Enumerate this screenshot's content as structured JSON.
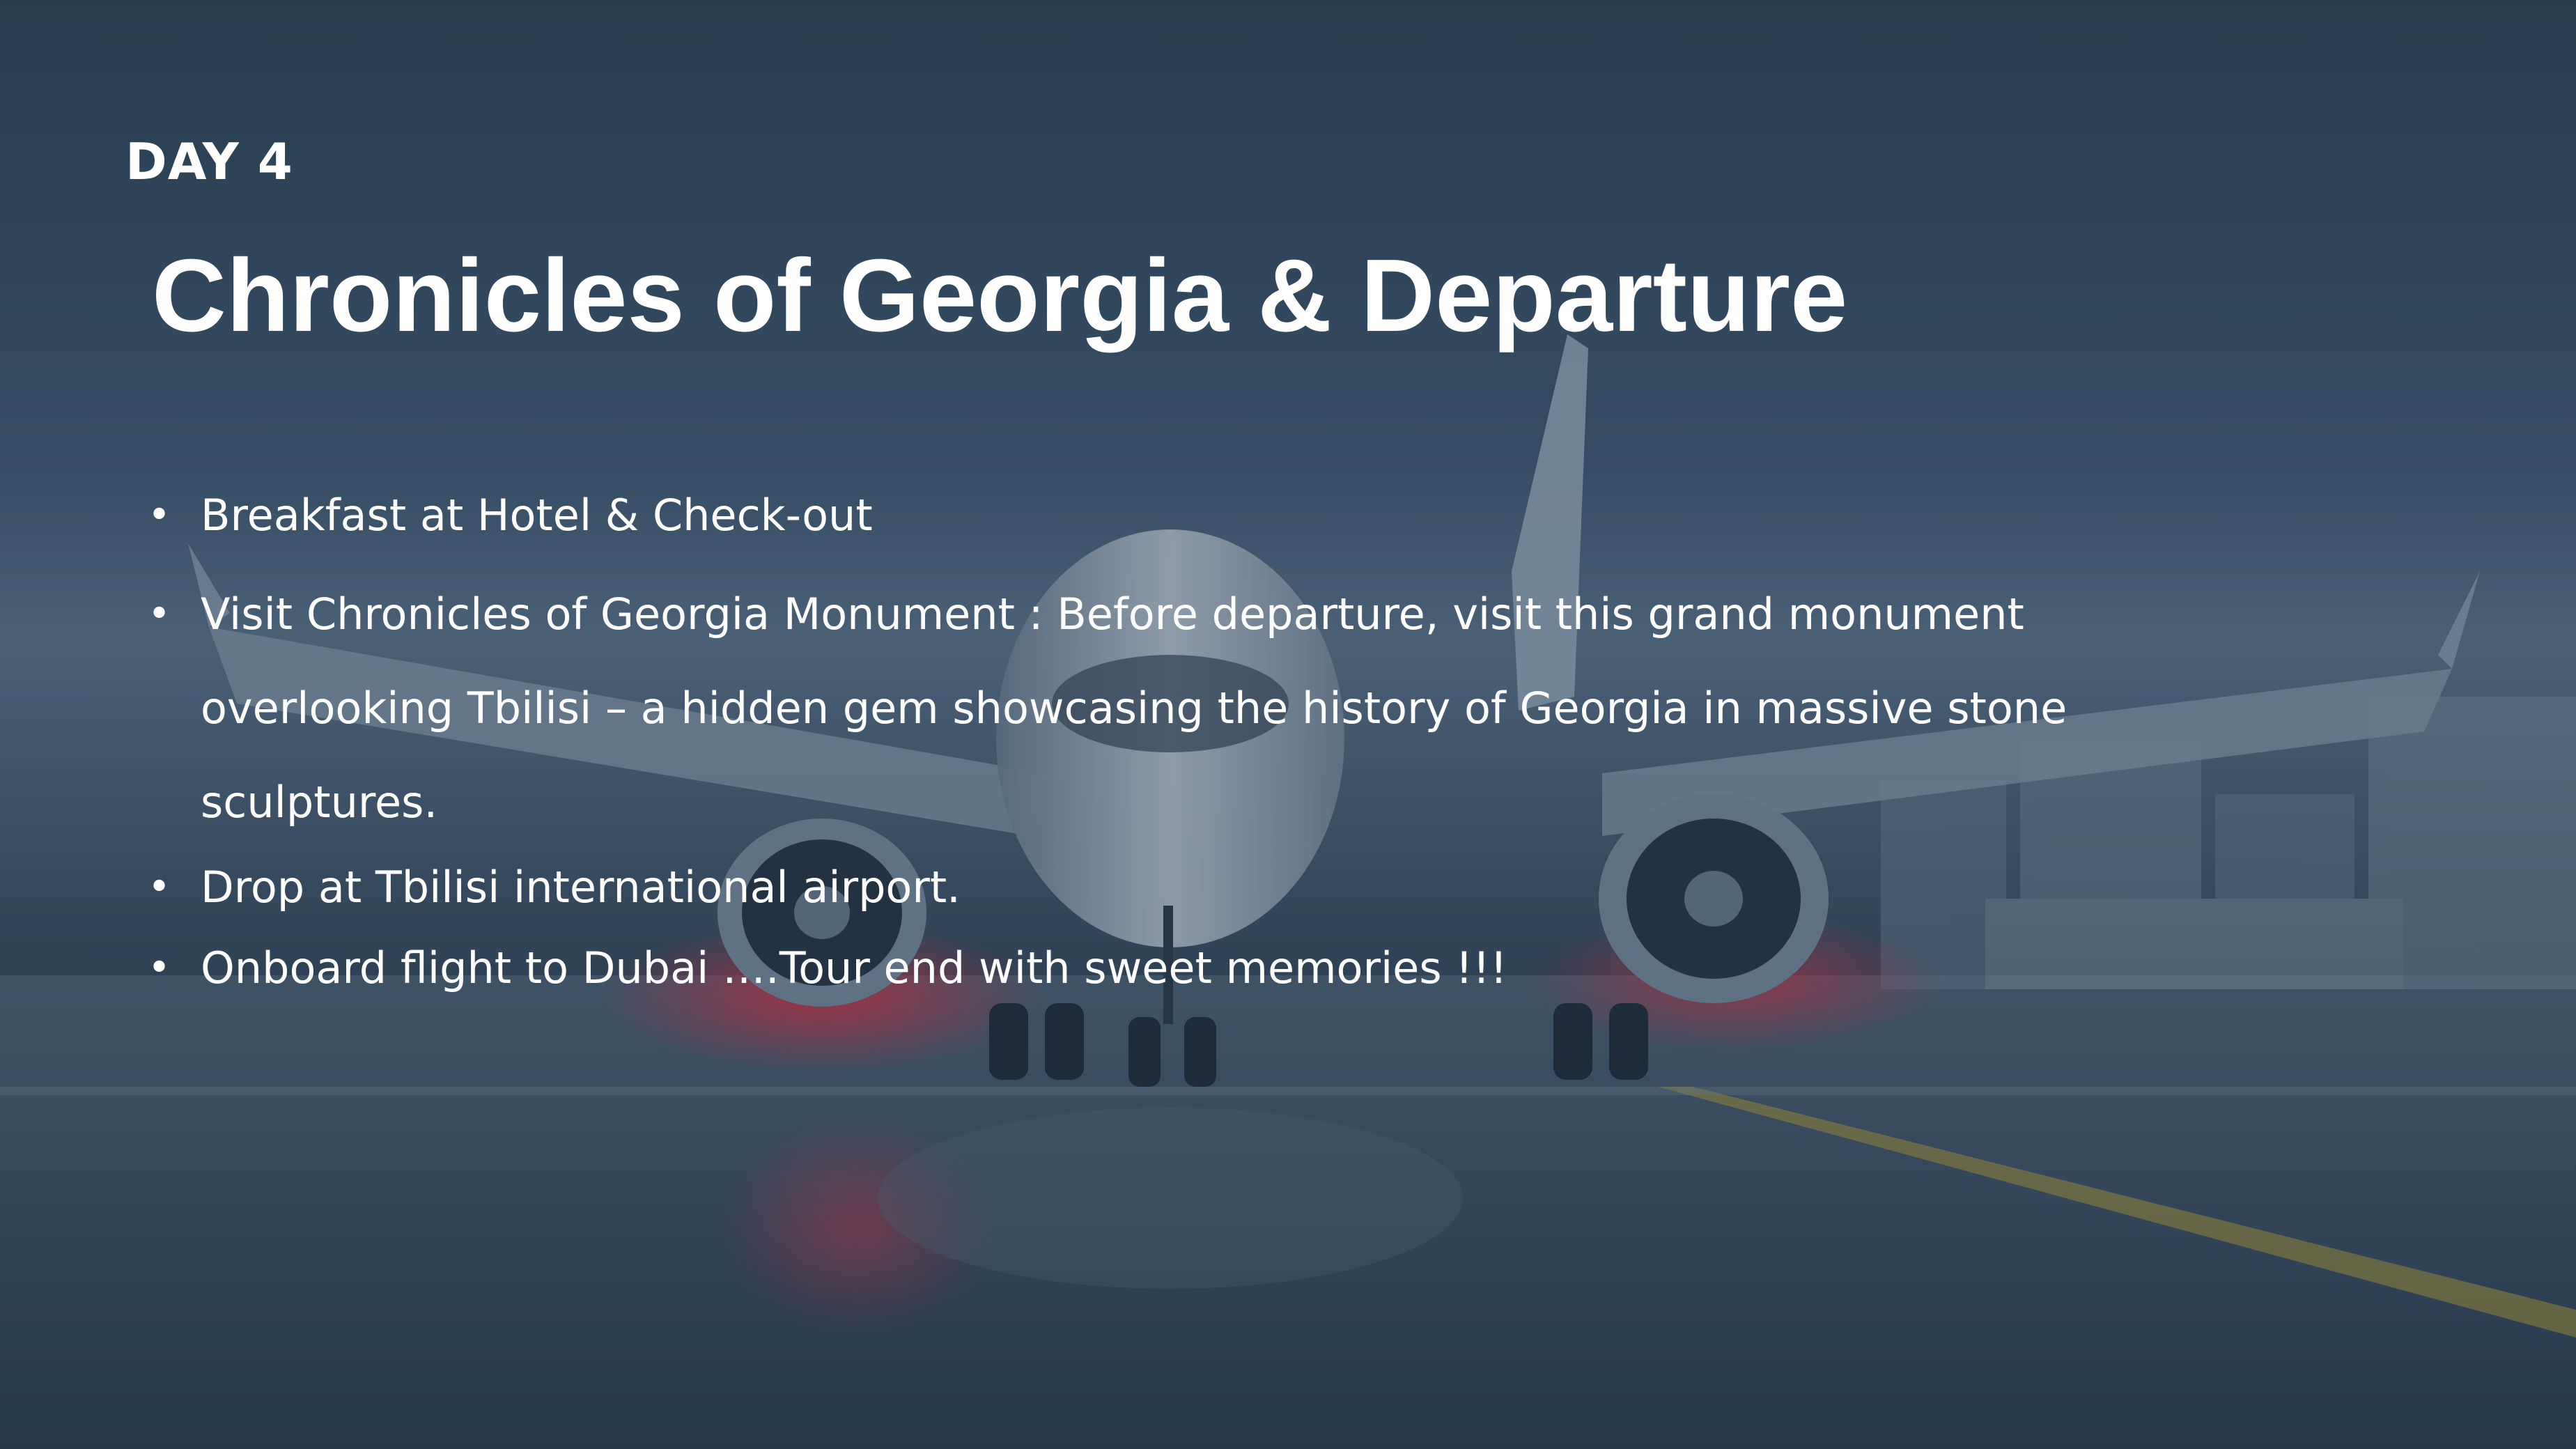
{
  "slide": {
    "day_label": "DAY 4",
    "title": "Chronicles of Georgia & Departure",
    "bullet_symbol": "•",
    "bullets": [
      "Breakfast at Hotel & Check-out",
      "Visit Chronicles of Georgia Monument : Before departure, visit this grand monument overlooking Tbilisi – a hidden gem showcasing the history of Georgia in massive stone sculptures.",
      "Drop at Tbilisi international airport.",
      "Onboard flight to Dubai ….Tour end with sweet memories !!!"
    ]
  },
  "colors": {
    "text": "#ffffff",
    "sky": "#3a5068",
    "tarmac": "#3b4f63",
    "engine_glow": "#d0283a"
  },
  "background": {
    "subject": "airplane-on-runway-photo"
  }
}
